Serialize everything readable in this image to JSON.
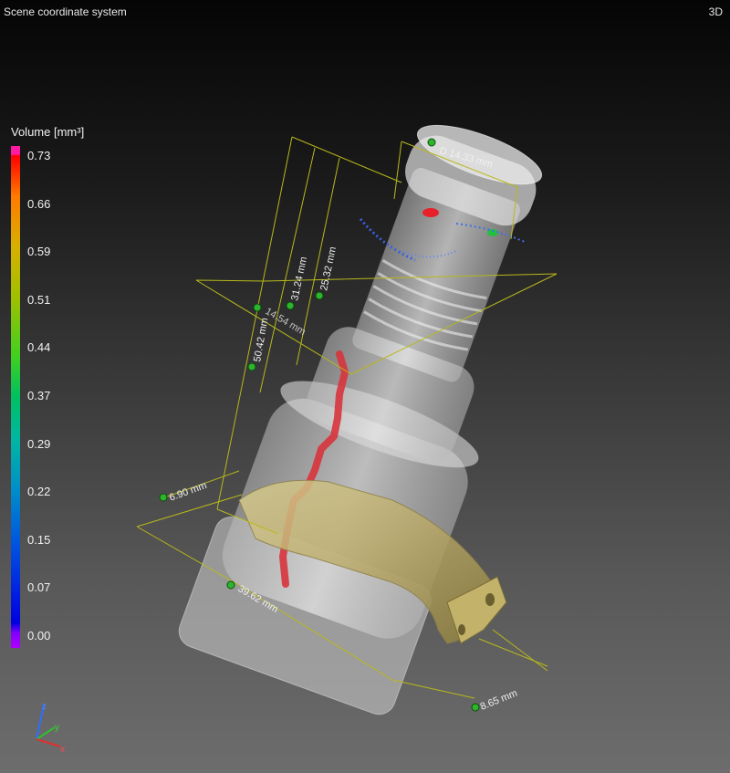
{
  "header": {
    "title": "Scene coordinate system",
    "mode": "3D"
  },
  "legend": {
    "title": "Volume [mm³]",
    "ticks": [
      "0.73",
      "0.66",
      "0.59",
      "0.51",
      "0.44",
      "0.37",
      "0.29",
      "0.22",
      "0.15",
      "0.07",
      "0.00"
    ]
  },
  "measurements": {
    "diameter": "D 14.33 mm",
    "h1": "50.42 mm",
    "h2": "31.24 mm",
    "h3": "25.32 mm",
    "w1": "14.54 mm",
    "w2": "6.90 mm",
    "w3": "39.62 mm",
    "w4": "8.65 mm"
  },
  "axes": {
    "x": "x",
    "y": "y",
    "z": "z"
  }
}
